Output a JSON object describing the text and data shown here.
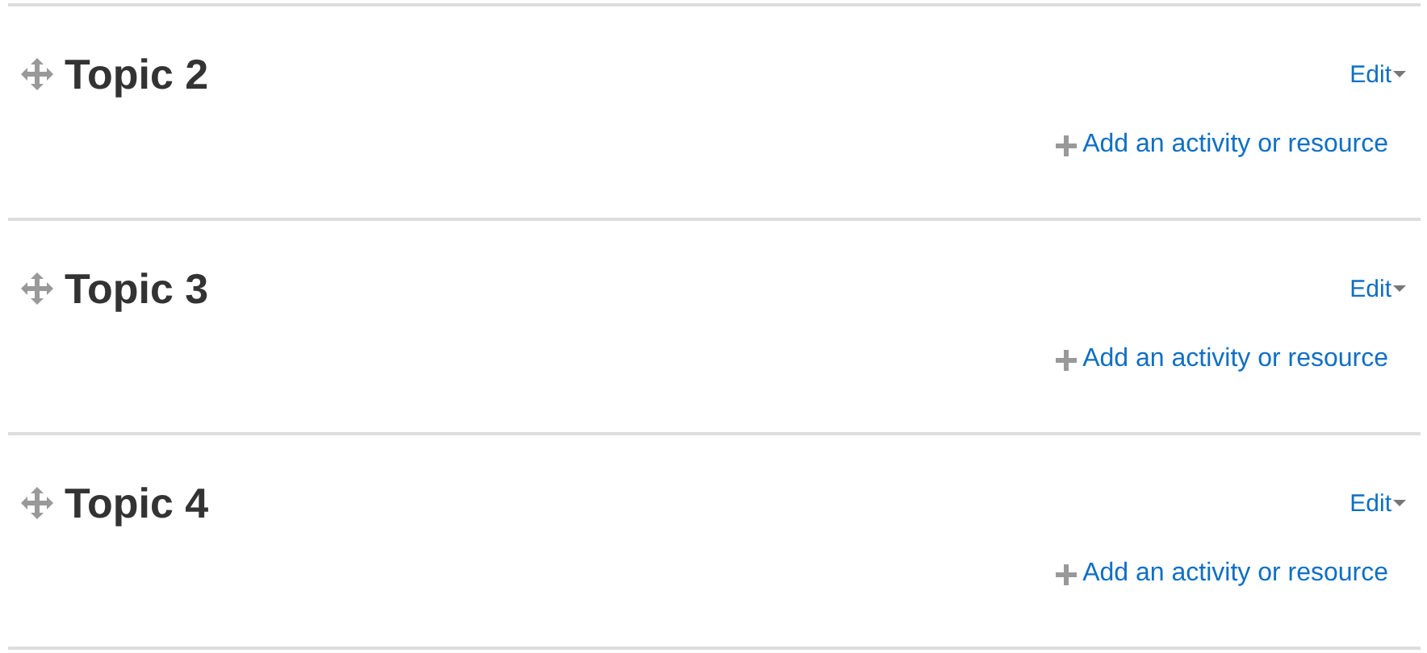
{
  "sections": [
    {
      "title": "Topic 2",
      "edit": "Edit",
      "add": "Add an activity or resource"
    },
    {
      "title": "Topic 3",
      "edit": "Edit",
      "add": "Add an activity or resource"
    },
    {
      "title": "Topic 4",
      "edit": "Edit",
      "add": "Add an activity or resource"
    }
  ]
}
